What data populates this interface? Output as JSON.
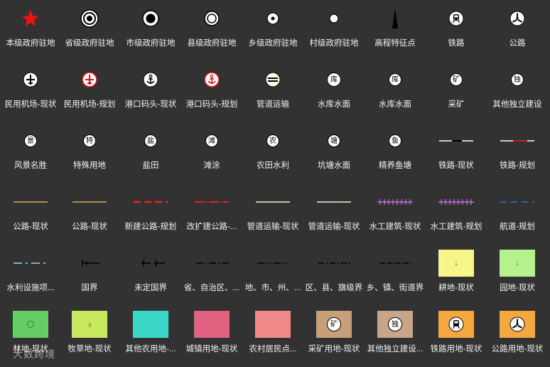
{
  "legend": [
    {
      "label": "本级政府驻地",
      "icon": "red-star-icon"
    },
    {
      "label": "省级政府驻地",
      "icon": "concentric-circles-icon"
    },
    {
      "label": "市级政府驻地",
      "icon": "filled-circle-ring-icon"
    },
    {
      "label": "县级政府驻地",
      "icon": "double-ring-icon"
    },
    {
      "label": "乡级政府驻地",
      "icon": "dot-ring-icon"
    },
    {
      "label": "村级政府驻地",
      "icon": "small-circle-icon"
    },
    {
      "label": "高程特征点",
      "icon": "elevation-spike-icon"
    },
    {
      "label": "铁路",
      "icon": "train-icon"
    },
    {
      "label": "公路",
      "icon": "road-tri-icon"
    },
    {
      "label": "民用机场-现状",
      "icon": "airport-existing-icon"
    },
    {
      "label": "民用机场-规划",
      "icon": "airport-planned-icon"
    },
    {
      "label": "港口码头-现状",
      "icon": "port-existing-icon"
    },
    {
      "label": "港口码头-规划",
      "icon": "port-planned-icon"
    },
    {
      "label": "管道运输",
      "icon": "pipeline-icon"
    },
    {
      "label": "水库水面",
      "icon": "reservoir-icon",
      "glyph": "库"
    },
    {
      "label": "水库水面",
      "icon": "reservoir-icon",
      "glyph": "库"
    },
    {
      "label": "采矿",
      "icon": "mining-icon",
      "glyph": "矿"
    },
    {
      "label": "其他独立建设",
      "icon": "independent-construction-icon",
      "glyph": "独"
    },
    {
      "label": "风景名胜",
      "icon": "scenic-icon",
      "glyph": "景"
    },
    {
      "label": "特殊用地",
      "icon": "special-land-icon",
      "glyph": "特"
    },
    {
      "label": "盐田",
      "icon": "salt-field-icon",
      "glyph": "盐"
    },
    {
      "label": "滩涂",
      "icon": "tidal-flat-icon",
      "glyph": "滩"
    },
    {
      "label": "农田水利",
      "icon": "farmland-water-icon",
      "glyph": "农"
    },
    {
      "label": "坑塘水面",
      "icon": "pond-icon",
      "glyph": "塘"
    },
    {
      "label": "精养鱼塘",
      "icon": "fish-pond-icon",
      "glyph": "鱼"
    },
    {
      "label": "铁路-现状",
      "icon": "railway-line-existing-icon"
    },
    {
      "label": "铁路-规划",
      "icon": "railway-line-planned-icon"
    },
    {
      "label": "公路-现状",
      "icon": "road-line-icon"
    },
    {
      "label": "公路-现状",
      "icon": "road-line-icon"
    },
    {
      "label": "新建公路-规划",
      "icon": "new-road-planned-icon"
    },
    {
      "label": "改扩建公路-...",
      "icon": "rebuild-road-icon"
    },
    {
      "label": "管道运输-现状",
      "icon": "pipeline-line-icon"
    },
    {
      "label": "管道运输-现状",
      "icon": "pipeline-line-icon"
    },
    {
      "label": "水工建筑-现状",
      "icon": "hydraulic-existing-icon"
    },
    {
      "label": "水工建筑-规划",
      "icon": "hydraulic-planned-icon"
    },
    {
      "label": "航道-规划",
      "icon": "waterway-planned-icon"
    },
    {
      "label": "水利设施项...",
      "icon": "water-facility-line-icon"
    },
    {
      "label": "国界",
      "icon": "national-border-icon"
    },
    {
      "label": "未定国界",
      "icon": "undetermined-border-icon"
    },
    {
      "label": "省、自治区、...",
      "icon": "province-border-icon"
    },
    {
      "label": "地、市、州、...",
      "icon": "city-border-icon"
    },
    {
      "label": "区、县、旗级界",
      "icon": "county-border-icon"
    },
    {
      "label": "乡、镇、街道界",
      "icon": "town-border-icon"
    },
    {
      "label": "耕地-现状",
      "icon": "cultivated-swatch-icon"
    },
    {
      "label": "园地-现状",
      "icon": "garden-swatch-icon"
    },
    {
      "label": "林地-现状",
      "icon": "forest-swatch-icon"
    },
    {
      "label": "牧草地-现状",
      "icon": "grassland-swatch-icon"
    },
    {
      "label": "其他农用地-...",
      "icon": "other-agri-swatch-icon"
    },
    {
      "label": "城镇用地-现状",
      "icon": "urban-swatch-icon"
    },
    {
      "label": "农村居民点...",
      "icon": "rural-swatch-icon"
    },
    {
      "label": "采矿用地-现状",
      "icon": "mining-swatch-icon",
      "glyph": "矿"
    },
    {
      "label": "其他独立建设...",
      "icon": "independent-swatch-icon",
      "glyph": "独"
    },
    {
      "label": "铁路用地-现状",
      "icon": "railway-land-swatch-icon"
    },
    {
      "label": "公路用地-现状",
      "icon": "road-land-swatch-icon"
    }
  ],
  "colors": {
    "background": "#323232",
    "cultivated": "#f7f68a",
    "garden": "#b5f28e",
    "forest": "#66cc66",
    "grassland": "#c8e860",
    "other_agri": "#3ad6c8",
    "urban": "#e06080",
    "rural": "#f08a88",
    "mining": "#c7a07a",
    "independent": "#c8a488",
    "railway_land": "#f5a840",
    "road_land": "#f5a840"
  },
  "watermark": "大数跨境"
}
